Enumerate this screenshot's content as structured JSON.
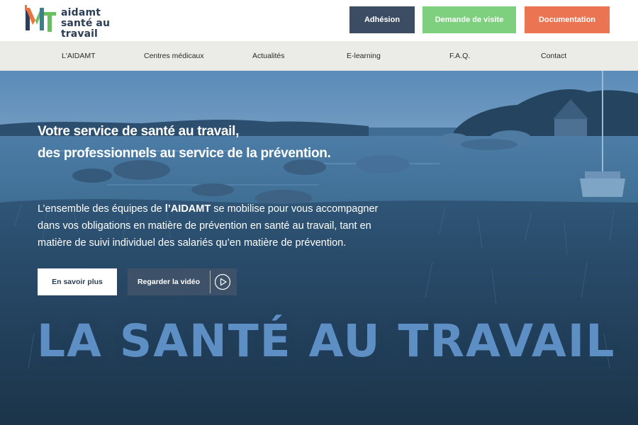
{
  "brand": {
    "logo_mark": "MT",
    "name_line1": "aidamt",
    "name_line2": "santé au travail",
    "colors": {
      "navy": "#2c3e57",
      "green": "#6abf5e",
      "orange": "#e8743f",
      "teal": "#3f7f8a"
    }
  },
  "header": {
    "buttons": {
      "adhesion": "Adhésion",
      "visite": "Demande de visite",
      "documentation": "Documentation"
    },
    "colors": {
      "adhesion": "#3b4c63",
      "visite": "#7fd07e",
      "documentation": "#eb7452"
    }
  },
  "nav": {
    "items": [
      "L'AIDAMT",
      "Centres médicaux",
      "Actualités",
      "E-learning",
      "F.A.Q.",
      "Contact"
    ]
  },
  "hero": {
    "title_line1": "Votre service de santé au travail,",
    "title_line2": "des professionnels au service de la prévention.",
    "text_line1_a": "L’ensemble des équipes de ",
    "text_line1_b": "l’AIDAMT",
    "text_line1_c": " se mobilise pour vous accompagner",
    "text_line2": "dans vos obligations en matière de prévention en santé au travail, tant en",
    "text_line3": "matière de suivi individuel des salariés qu’en matière de prévention.",
    "more_label": "En savoir plus",
    "video_label": "Regarder la vidéo",
    "play_icon": "play-circle-icon",
    "tagline": "LA SANTÉ AU TRAVAIL",
    "colors": {
      "overlay": "#3f6d93",
      "tagline": "#5e8fc4"
    }
  }
}
